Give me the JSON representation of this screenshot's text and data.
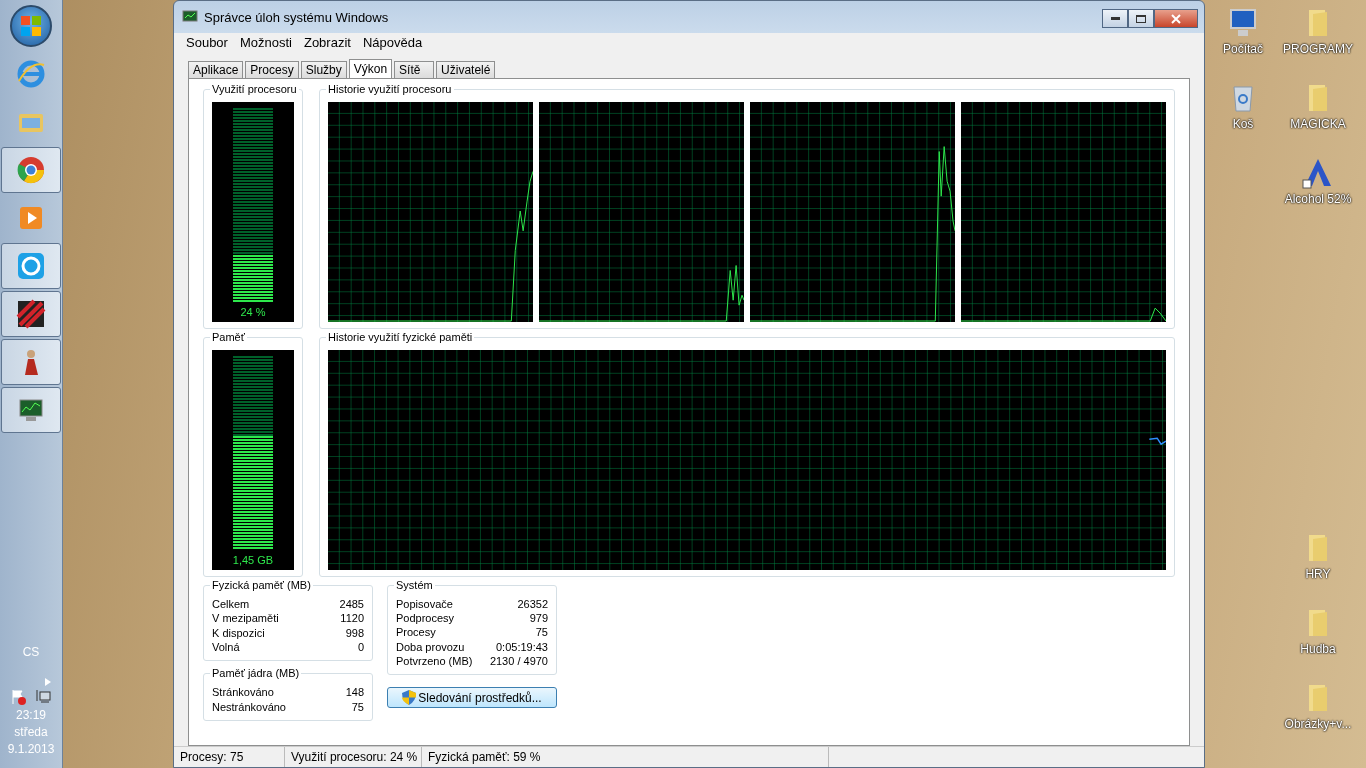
{
  "window": {
    "title": "Správce úloh systému Windows"
  },
  "menu": [
    "Soubor",
    "Možnosti",
    "Zobrazit",
    "Nápověda"
  ],
  "tabs": [
    {
      "label": "Aplikace",
      "selected": false
    },
    {
      "label": "Procesy",
      "selected": false
    },
    {
      "label": "Služby",
      "selected": false
    },
    {
      "label": "Výkon",
      "selected": true
    },
    {
      "label": "Sítě",
      "selected": false
    },
    {
      "label": "Uživatelé",
      "selected": false
    }
  ],
  "cpu": {
    "title": "Využití procesoru",
    "level": 0.24,
    "reading": "24 %"
  },
  "cpu_history": {
    "title": "Historie využití procesoru"
  },
  "memory": {
    "title": "Paměť",
    "level": 0.59,
    "reading": "1,45 GB"
  },
  "memory_history": {
    "title": "Historie využití fyzické paměti"
  },
  "physical_memory": {
    "title": "Fyzická paměť (MB)",
    "rows": [
      {
        "label": "Celkem",
        "value": "2485"
      },
      {
        "label": "V mezipaměti",
        "value": "1120"
      },
      {
        "label": "K dispozici",
        "value": "998"
      },
      {
        "label": "Volná",
        "value": "0"
      }
    ]
  },
  "kernel_memory": {
    "title": "Paměť jádra (MB)",
    "rows": [
      {
        "label": "Stránkováno",
        "value": "148"
      },
      {
        "label": "Nestránkováno",
        "value": "75"
      }
    ]
  },
  "system": {
    "title": "Systém",
    "rows": [
      {
        "label": "Popisovače",
        "value": "26352"
      },
      {
        "label": "Podprocesy",
        "value": "979"
      },
      {
        "label": "Procesy",
        "value": "75"
      },
      {
        "label": "Doba provozu",
        "value": "0:05:19:43"
      },
      {
        "label": "Potvrzeno (MB)",
        "value": "2130 / 4970"
      }
    ]
  },
  "resource_monitor_button": "Sledování prostředků...",
  "status_bar": [
    "Procesy: 75",
    "Využití procesoru: 24 %",
    "Fyzická paměť: 59 %"
  ],
  "taskbar": {
    "apps": [
      {
        "kind": "browser-e",
        "running": false
      },
      {
        "kind": "folders",
        "running": false
      },
      {
        "kind": "browser-round",
        "running": true
      },
      {
        "kind": "player",
        "running": false
      },
      {
        "kind": "chat",
        "running": true
      },
      {
        "kind": "stripes",
        "running": true
      },
      {
        "kind": "figure",
        "running": true
      },
      {
        "kind": "monitor",
        "running": true
      }
    ],
    "language": "CS",
    "time": "23:19",
    "day": "středa",
    "date": "9.1.2013"
  },
  "desktop_icons": [
    {
      "label": "Počítač",
      "kind": "computer"
    },
    {
      "label": "PROGRAMY",
      "kind": "folder"
    },
    {
      "label": "Koš",
      "kind": "bin"
    },
    {
      "label": "MAGICKA",
      "kind": "folder"
    },
    {
      "label": "Alcohol 52%",
      "kind": "shortcut"
    },
    {
      "label": "HRY",
      "kind": "folder"
    },
    {
      "label": "Hudba",
      "kind": "folder"
    },
    {
      "label": "Obrázky+v...",
      "kind": "folder"
    }
  ]
}
